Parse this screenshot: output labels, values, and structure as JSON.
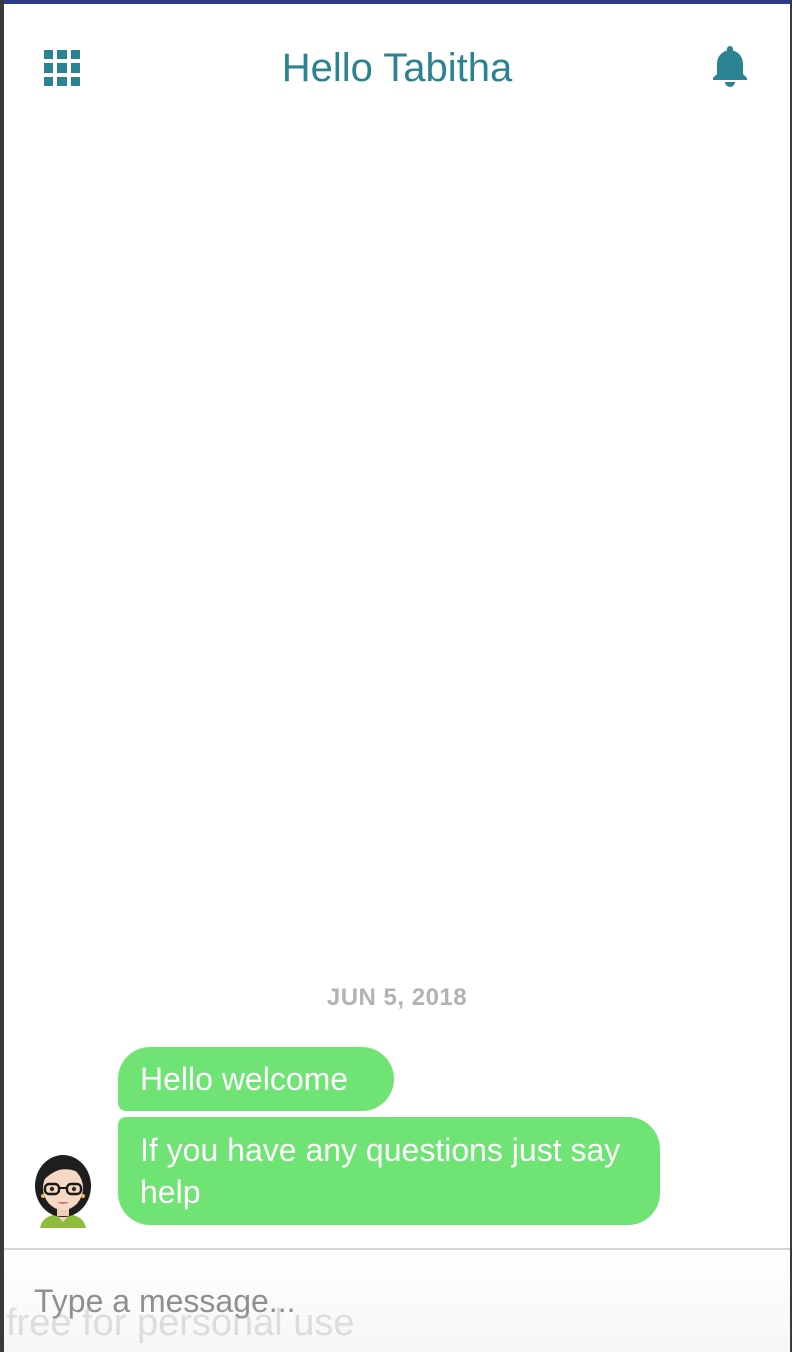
{
  "header": {
    "title": "Hello Tabitha",
    "menu_icon": "grid-apps-icon",
    "notification_icon": "bell-icon"
  },
  "chat": {
    "date_divider": "JUN 5, 2018",
    "messages": [
      {
        "text": "Hello welcome",
        "sender": "bot"
      },
      {
        "text": "If you have any questions just say help",
        "sender": "bot"
      }
    ],
    "avatar_icon": "female-avatar-icon"
  },
  "composer": {
    "placeholder": "Type a message..."
  },
  "watermark": "free for personal use",
  "colors": {
    "accent": "#2a8390",
    "bubble": "#6fe374",
    "bubble_text": "#ffffff",
    "date_text": "#b3b3b3",
    "top_strip": "#2e3b8c"
  }
}
